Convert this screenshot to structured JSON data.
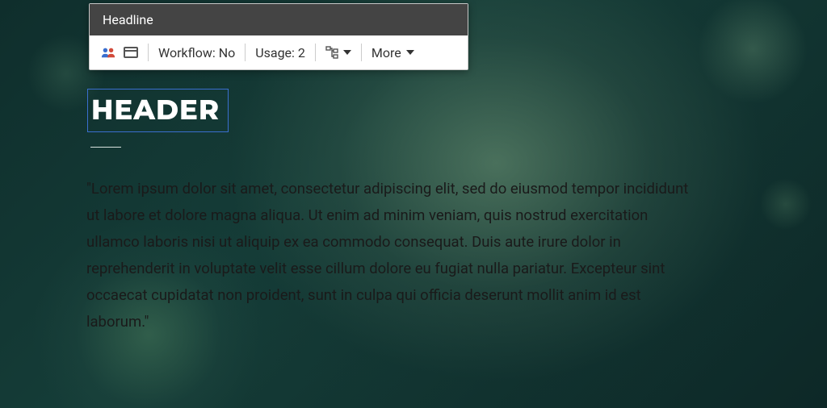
{
  "cms_panel": {
    "title": "Headline",
    "toolbar": {
      "workflow_label": "Workflow: No",
      "usage_label": "Usage: 2",
      "more_label": "More"
    }
  },
  "content": {
    "header": "HEADER",
    "body": "\"Lorem ipsum dolor sit amet, consectetur adipiscing elit, sed do eiusmod tempor incididunt ut labore et dolore magna aliqua. Ut enim ad minim veniam, quis nostrud exercitation ullamco laboris nisi ut aliquip ex ea commodo consequat. Duis aute irure dolor in reprehenderit in voluptate velit esse cillum dolore eu fugiat nulla pariatur. Excepteur sint occaecat cupidatat non proident, sunt in culpa qui officia deserunt mollit anim id est laborum.\""
  }
}
